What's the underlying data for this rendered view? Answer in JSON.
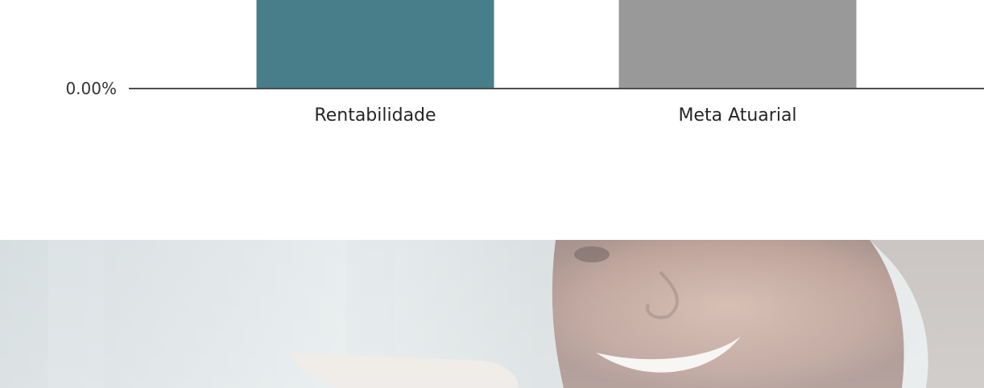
{
  "chart_data": {
    "type": "bar",
    "title": "",
    "xlabel": "",
    "ylabel": "",
    "categories": [
      "Rentabilidade",
      "Meta Atuarial"
    ],
    "series": [
      {
        "values": [
          null,
          null
        ],
        "colors": [
          "#477e8a",
          "#999999"
        ]
      }
    ],
    "y_ticks_visible": [
      "0.00%"
    ],
    "grid": false,
    "legend": "none",
    "note": "Chart is cropped at the top; bar values are not visible."
  },
  "banner": {
    "image": "photo-woman-smiling-with-phone",
    "faded": true
  },
  "colors": {
    "bar_rentabilidade": "#477e8a",
    "bar_meta_atuarial": "#999999",
    "axis": "#4d4d4d",
    "text": "#262626"
  }
}
